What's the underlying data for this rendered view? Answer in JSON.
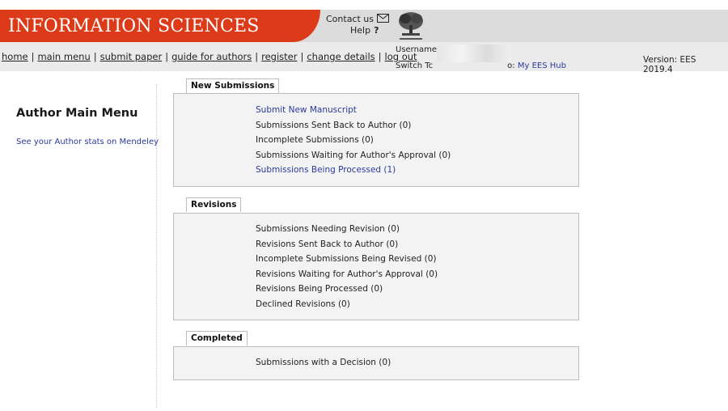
{
  "header": {
    "journal_title": "INFORMATION SCIENCES",
    "contact_label": "Contact us",
    "help_label": "Help",
    "help_glyph": "?",
    "logo_icon": "elsevier-tree-logo-icon",
    "accent_color": "#dc3a18"
  },
  "nav": {
    "links": [
      "home",
      "main menu",
      "submit paper",
      "guide for authors",
      "register",
      "change details",
      "log out"
    ]
  },
  "user_info": {
    "username_label": "Username",
    "switch_prefix": "Switch Tc",
    "switch_suffix": "o:",
    "hub_link": "My EES Hub"
  },
  "version": "Version: EES 2019.4",
  "sidebar": {
    "title": "Author Main Menu",
    "mendeley_link": "See your Author stats on Mendeley"
  },
  "sections": [
    {
      "title": "New Submissions",
      "items": [
        {
          "label": "Submit New Manuscript",
          "link": true
        },
        {
          "label": "Submissions Sent Back to Author (0)",
          "link": false
        },
        {
          "label": "Incomplete Submissions (0)",
          "link": false
        },
        {
          "label": "Submissions Waiting for Author's Approval (0)",
          "link": false
        },
        {
          "label": "Submissions Being Processed (1)",
          "link": true
        }
      ]
    },
    {
      "title": "Revisions",
      "items": [
        {
          "label": "Submissions Needing Revision (0)",
          "link": false
        },
        {
          "label": "Revisions Sent Back to Author (0)",
          "link": false
        },
        {
          "label": "Incomplete Submissions Being Revised (0)",
          "link": false
        },
        {
          "label": "Revisions Waiting for Author's Approval (0)",
          "link": false
        },
        {
          "label": "Revisions Being Processed (0)",
          "link": false
        },
        {
          "label": "Declined Revisions (0)",
          "link": false
        }
      ]
    },
    {
      "title": "Completed",
      "items": [
        {
          "label": "Submissions with a Decision (0)",
          "link": false
        }
      ]
    }
  ]
}
